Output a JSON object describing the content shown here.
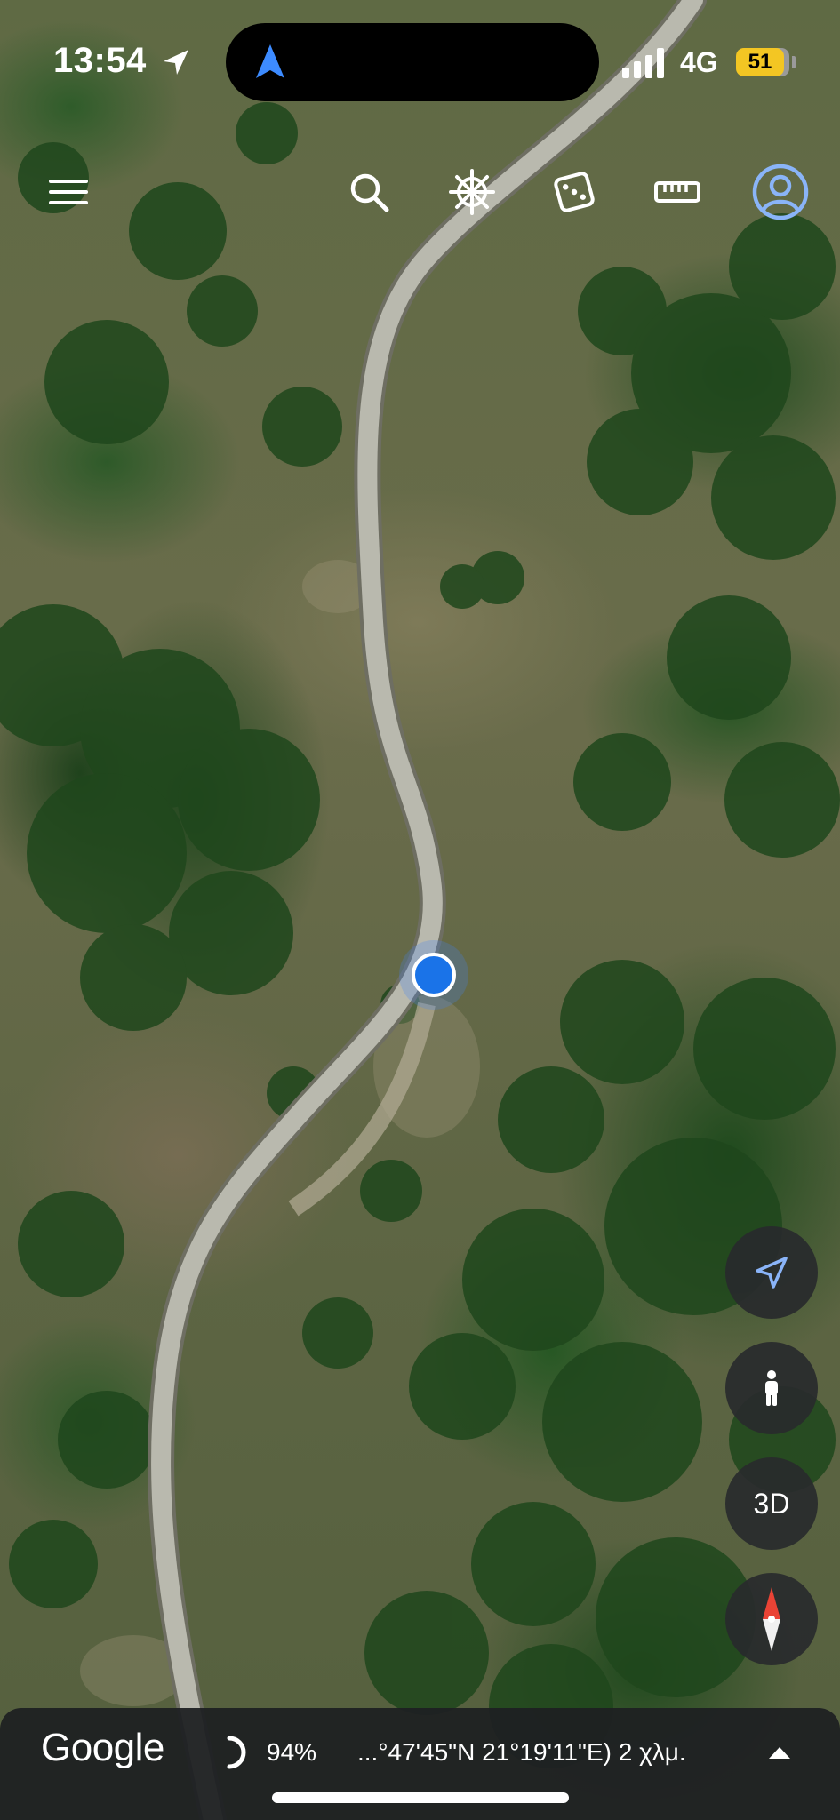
{
  "status_bar": {
    "time": "13:54",
    "network": "4G",
    "battery": "51",
    "battery_color": "#f3c623"
  },
  "toolbar": {
    "menu_icon": "menu-icon",
    "search_icon": "search-icon",
    "voyager_icon": "ship-wheel-icon",
    "feeling_lucky_icon": "dice-icon",
    "measure_icon": "ruler-icon",
    "account_icon": "account-circle-icon"
  },
  "controls": {
    "my_location_icon": "navigation-arrow-icon",
    "street_view_icon": "pegman-icon",
    "view_mode": "3D",
    "compass_icon": "compass-icon"
  },
  "bottom_bar": {
    "logo": "Google",
    "loading_percent": "94%",
    "coordinates": "...°47'45\"N 21°19'11\"E) 2 χλμ."
  },
  "colors": {
    "accent": "#1a73e8",
    "icon_blue": "#8ab4f8",
    "compass_red": "#ea4335"
  }
}
